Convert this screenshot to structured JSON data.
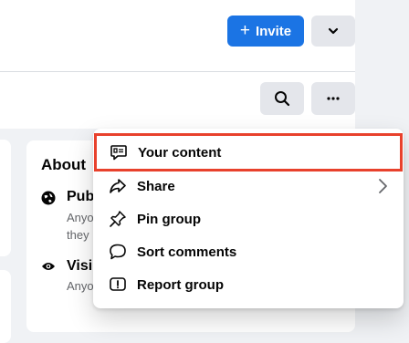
{
  "header": {
    "invite_label": "Invite"
  },
  "about": {
    "title": "About",
    "rows": [
      {
        "title": "Pub",
        "sub1": "Anyo",
        "sub2": "they"
      },
      {
        "title": "Visil",
        "sub1": "Anyo"
      }
    ]
  },
  "menu": {
    "items": [
      {
        "label": "Your content",
        "icon": "your-content-icon"
      },
      {
        "label": "Share",
        "icon": "share-icon"
      },
      {
        "label": "Pin group",
        "icon": "pin-icon"
      },
      {
        "label": "Sort comments",
        "icon": "comment-icon"
      },
      {
        "label": "Report group",
        "icon": "report-icon"
      }
    ]
  },
  "colors": {
    "primary": "#1b74e4",
    "highlight_border": "#e8412c",
    "button_gray": "#e4e6eb",
    "page_bg": "#f0f2f5"
  }
}
